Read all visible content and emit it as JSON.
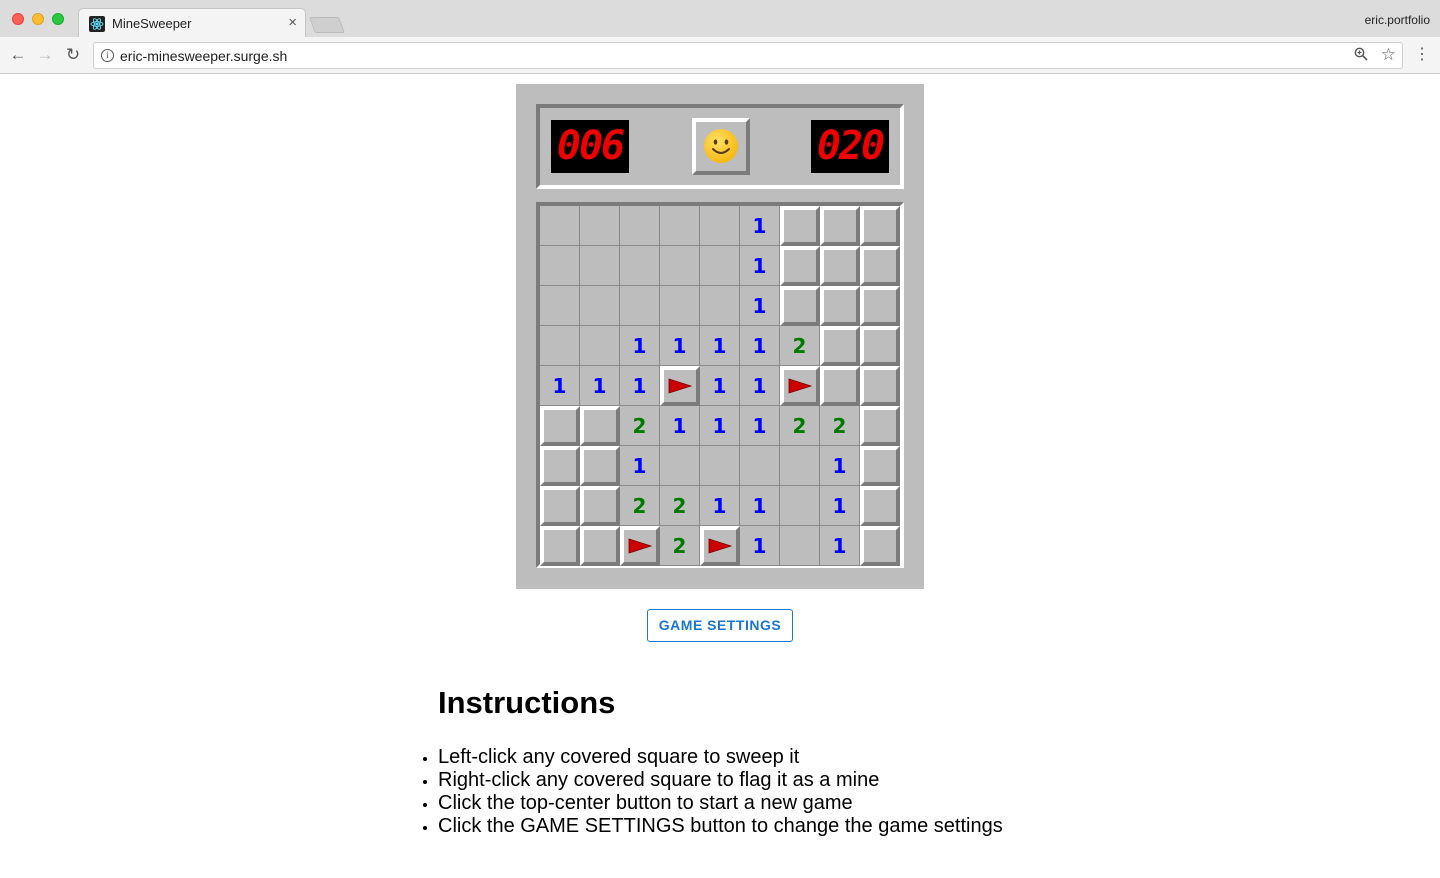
{
  "browser": {
    "tab_title": "MineSweeper",
    "tab_close": "×",
    "profile": "eric.portfolio",
    "url": "eric-minesweeper.surge.sh"
  },
  "game": {
    "mines_left": "006",
    "timer": "020",
    "face": "smiley-face",
    "board": [
      [
        "o",
        "o",
        "o",
        "o",
        "o",
        "1",
        "c",
        "c",
        "c"
      ],
      [
        "o",
        "o",
        "o",
        "o",
        "o",
        "1",
        "c",
        "c",
        "c"
      ],
      [
        "o",
        "o",
        "o",
        "o",
        "o",
        "1",
        "c",
        "c",
        "c"
      ],
      [
        "o",
        "o",
        "1",
        "1",
        "1",
        "1",
        "2",
        "c",
        "c"
      ],
      [
        "1",
        "1",
        "1",
        "F",
        "1",
        "1",
        "F",
        "c",
        "c"
      ],
      [
        "c",
        "c",
        "2",
        "1",
        "1",
        "1",
        "2",
        "2",
        "c"
      ],
      [
        "c",
        "c",
        "1",
        "o",
        "o",
        "o",
        "o",
        "1",
        "c"
      ],
      [
        "c",
        "c",
        "2",
        "2",
        "1",
        "1",
        "o",
        "1",
        "c"
      ],
      [
        "c",
        "c",
        "F",
        "2",
        "F",
        "1",
        "o",
        "1",
        "c"
      ]
    ],
    "colors": {
      "one": "#0000ff",
      "two": "#007b00",
      "flag": "#cc0000"
    }
  },
  "settings_button": "GAME SETTINGS",
  "instructions": {
    "title": "Instructions",
    "items": [
      "Left-click any covered square to sweep it",
      "Right-click any covered square to flag it as a mine",
      "Click the top-center button to start a new game",
      "Click the GAME SETTINGS button to change the game settings"
    ]
  }
}
